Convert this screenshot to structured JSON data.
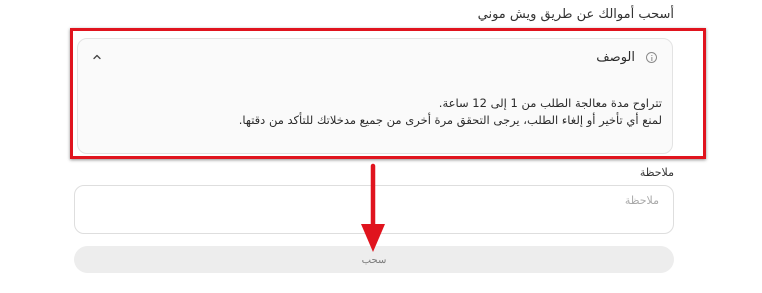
{
  "method_title": "أسحب أموالك عن طريق ويش موني",
  "description": {
    "header_label": "الوصف",
    "line_1": "تتراوح مدة معالجة الطلب من 1 إلى 12 ساعة.",
    "line_2": "لمنع أي تأخير أو إلغاء الطلب، يرجى التحقق مرة أخرى من جميع مدخلاتك للتأكد من دقتها.",
    "expanded": true
  },
  "note": {
    "label": "ملاحظة",
    "placeholder": "ملاحظة",
    "value": ""
  },
  "withdraw_button": {
    "label": "سحب"
  },
  "icons": {
    "info": "info-icon",
    "collapse": "chevron-up-icon",
    "annotation": "arrow-down-icon"
  },
  "colors": {
    "annotation_red": "#e0141e",
    "button_bg": "#ededed",
    "card_bg": "#fafafa"
  }
}
